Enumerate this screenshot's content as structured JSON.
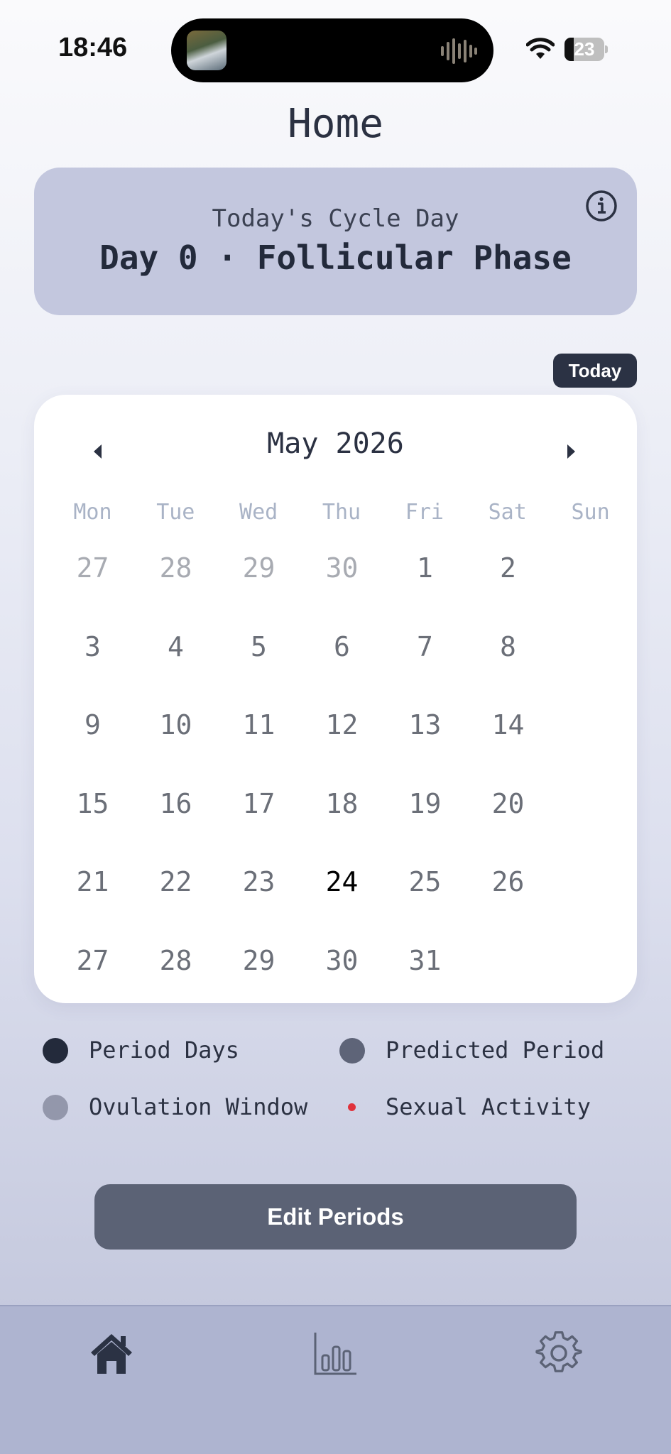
{
  "status_bar": {
    "time": "18:46",
    "battery_level": 23,
    "battery_label": "23"
  },
  "header": {
    "title": "Home"
  },
  "cycle_card": {
    "label": "Today's Cycle Day",
    "value": "Day 0 · Follicular Phase",
    "info_icon": "info-circle-icon"
  },
  "today_button": "Today",
  "calendar": {
    "month_label": "May 2026",
    "weekdays": [
      "Mon",
      "Tue",
      "Wed",
      "Thu",
      "Fri",
      "Sat",
      "Sun"
    ],
    "days": [
      {
        "label": "27",
        "muted": true
      },
      {
        "label": "28",
        "muted": true
      },
      {
        "label": "29",
        "muted": true
      },
      {
        "label": "30",
        "muted": true
      },
      {
        "label": "1"
      },
      {
        "label": "2"
      },
      {
        "label": "3"
      },
      {
        "label": "4"
      },
      {
        "label": "5"
      },
      {
        "label": "6"
      },
      {
        "label": "7"
      },
      {
        "label": "8"
      },
      {
        "label": "9"
      },
      {
        "label": "10"
      },
      {
        "label": "11"
      },
      {
        "label": "12"
      },
      {
        "label": "13"
      },
      {
        "label": "14"
      },
      {
        "label": "15"
      },
      {
        "label": "16"
      },
      {
        "label": "17"
      },
      {
        "label": "18"
      },
      {
        "label": "19"
      },
      {
        "label": "20"
      },
      {
        "label": "21"
      },
      {
        "label": "22"
      },
      {
        "label": "23"
      },
      {
        "label": "24",
        "today": true
      },
      {
        "label": "25"
      },
      {
        "label": "26"
      },
      {
        "label": "27"
      },
      {
        "label": "28"
      },
      {
        "label": "29"
      },
      {
        "label": "30"
      },
      {
        "label": "31"
      }
    ]
  },
  "legend": [
    {
      "label": "Period Days",
      "color": "#232a3b"
    },
    {
      "label": "Predicted Period",
      "color": "#5e6478"
    },
    {
      "label": "Ovulation Window",
      "color": "#9397ab"
    },
    {
      "label": "Sexual Activity",
      "color": "#e0323c"
    }
  ],
  "edit_button": "Edit Periods",
  "tabbar": {
    "tabs": [
      {
        "icon": "home-icon",
        "active": true
      },
      {
        "icon": "bar-chart-icon",
        "active": false
      },
      {
        "icon": "gear-icon",
        "active": false
      }
    ]
  }
}
